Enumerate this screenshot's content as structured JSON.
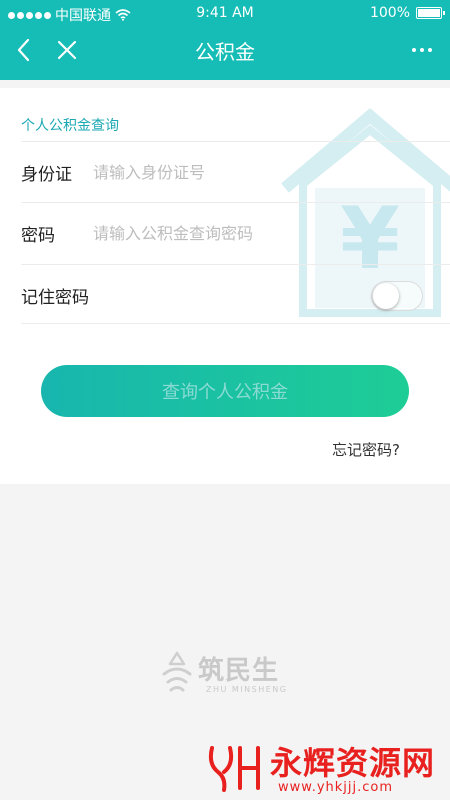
{
  "status_bar": {
    "carrier": "中国联通",
    "time": "9:41 AM",
    "battery": "100%"
  },
  "nav": {
    "title": "公积金"
  },
  "form": {
    "section_title": "个人公积金查询",
    "id_label": "身份证",
    "id_placeholder": "请输入身份证号",
    "password_label": "密码",
    "password_placeholder": "请输入公积金查询密码",
    "remember_label": "记住密码",
    "remember_on": false,
    "submit_label": "查询个人公积金",
    "forgot_label": "忘记密码?"
  },
  "brand": {
    "name": "筑民生",
    "subtitle": "ZHU MINSHENG"
  },
  "watermark": {
    "title": "永辉资源网",
    "url": "www.yhkjjj.com"
  },
  "colors": {
    "header": "#15bdb6",
    "accent": "#1aa8b3",
    "button_start": "#18b6ae",
    "button_end": "#1ecd96",
    "watermark": "#e8211f"
  },
  "icons": {
    "back": "chevron-left-icon",
    "close": "close-icon",
    "more": "more-icon",
    "house": "house-yuan-icon",
    "wifi": "wifi-icon",
    "battery": "battery-icon"
  }
}
